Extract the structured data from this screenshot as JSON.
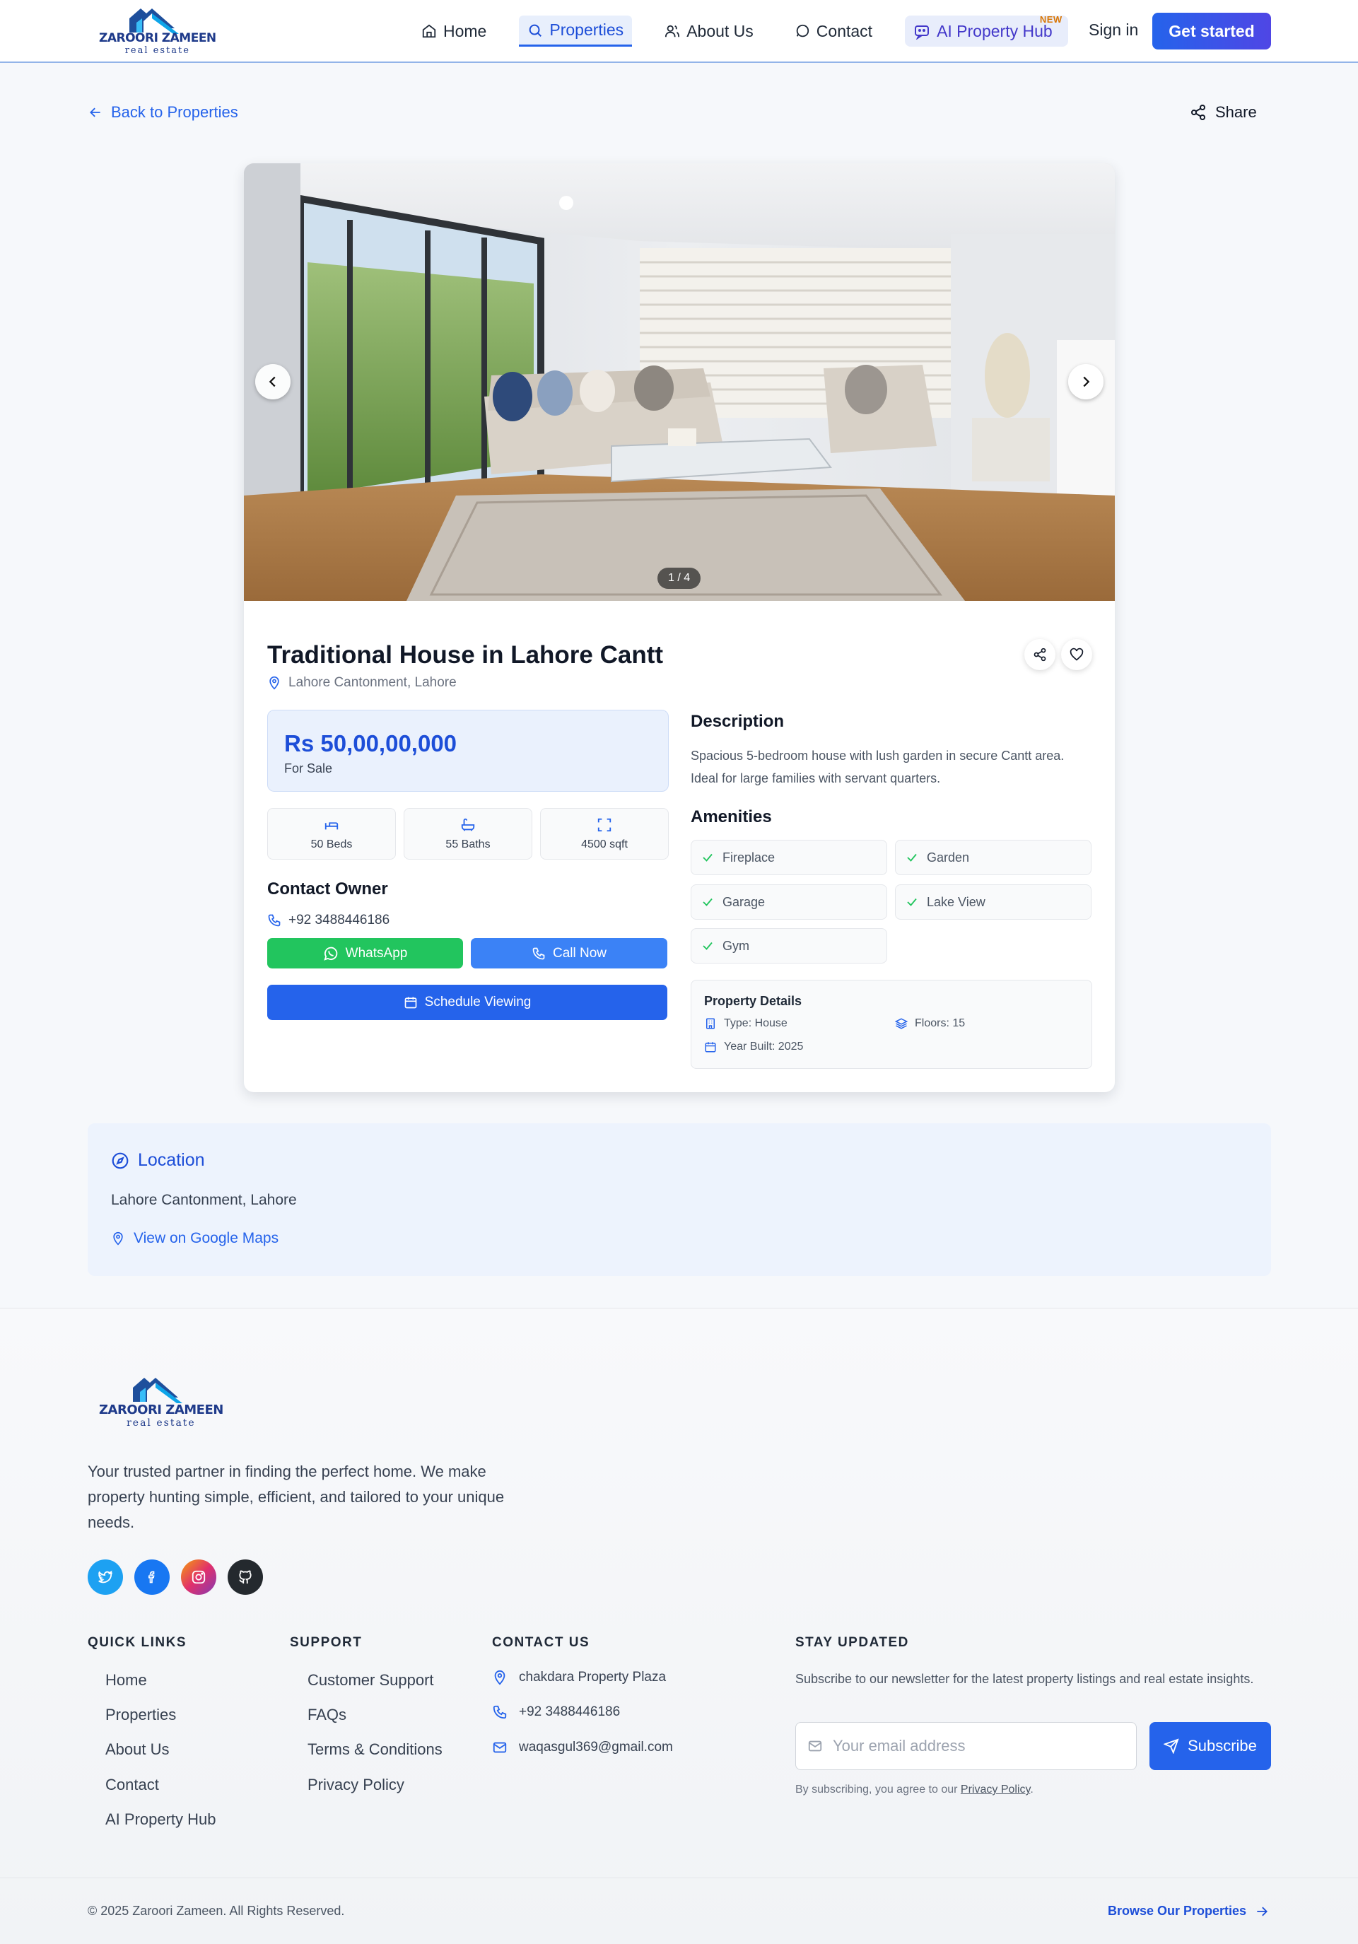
{
  "brand": {
    "name": "ZAROORI ZAMEEN",
    "tagline": "real estate"
  },
  "nav": {
    "home": "Home",
    "properties": "Properties",
    "about": "About Us",
    "contact": "Contact",
    "ai_hub": "AI Property Hub",
    "ai_badge": "NEW",
    "sign_in": "Sign in",
    "get_started": "Get started"
  },
  "page": {
    "back": "Back to Properties",
    "share": "Share"
  },
  "property": {
    "image_counter": "1 / 4",
    "title": "Traditional House in Lahore Cantt",
    "location": "Lahore Cantonment, Lahore",
    "price": "Rs 50,00,00,000",
    "status": "For Sale",
    "beds": "50 Beds",
    "baths": "55 Baths",
    "area": "4500 sqft",
    "contact_heading": "Contact Owner",
    "phone": "+92 3488446186",
    "whatsapp": "WhatsApp",
    "call_now": "Call Now",
    "schedule": "Schedule Viewing",
    "description_heading": "Description",
    "description": "Spacious 5-bedroom house with lush garden in secure Cantt area. Ideal for large families with servant quarters.",
    "amenities_heading": "Amenities",
    "amenities": [
      "Fireplace",
      "Garden",
      "Garage",
      "Lake View",
      "Gym"
    ],
    "details_heading": "Property Details",
    "type": "Type: House",
    "floors": "Floors: 15",
    "year_built": "Year Built: 2025"
  },
  "location_section": {
    "heading": "Location",
    "address": "Lahore Cantonment, Lahore",
    "map_link": "View on Google Maps"
  },
  "footer": {
    "about": "Your trusted partner in finding the perfect home. We make property hunting simple, efficient, and tailored to your unique needs.",
    "quick_links_heading": "QUICK LINKS",
    "quick_links": [
      "Home",
      "Properties",
      "About Us",
      "Contact",
      "AI Property Hub"
    ],
    "support_heading": "SUPPORT",
    "support_links": [
      "Customer Support",
      "FAQs",
      "Terms & Conditions",
      "Privacy Policy"
    ],
    "contact_heading": "CONTACT US",
    "address": "chakdara Property Plaza",
    "phone": "+92 3488446186",
    "email": "waqasgul369@gmail.com",
    "newsletter_heading": "STAY UPDATED",
    "newsletter_desc": "Subscribe to our newsletter for the latest property listings and real estate insights.",
    "email_placeholder": "Your email address",
    "subscribe": "Subscribe",
    "note_prefix": "By subscribing, you agree to our",
    "note_link": "Privacy Policy",
    "copyright": "© 2025 Zaroori Zameen. All Rights Reserved.",
    "browse": "Browse Our Properties"
  },
  "colors": {
    "primary": "#2563eb",
    "whatsapp": "#22c55e",
    "call": "#3b82f6",
    "accent_indigo": "#4f46e5"
  }
}
